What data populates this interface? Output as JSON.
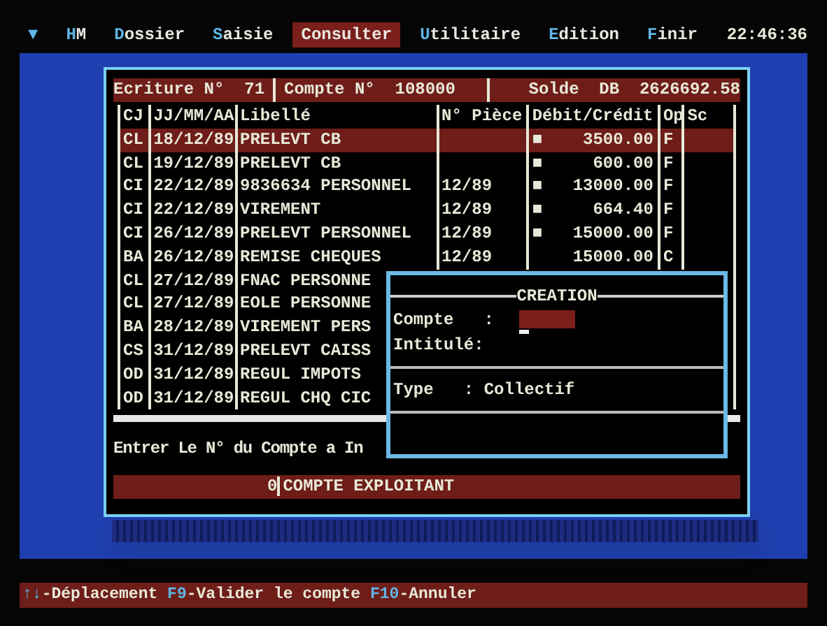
{
  "menu_bar": {
    "items": [
      {
        "label": "▼",
        "selected": false
      },
      {
        "label": "HM",
        "selected": false
      },
      {
        "label": "Dossier",
        "selected": false
      },
      {
        "label": "Saisie",
        "selected": false
      },
      {
        "label": "Consulter",
        "selected": true
      },
      {
        "label": "Utilitaire",
        "selected": false
      },
      {
        "label": "Edition",
        "selected": false
      },
      {
        "label": "Finir",
        "selected": false
      }
    ],
    "clock": "22:46:36"
  },
  "ledger": {
    "header": [
      {
        "label": "Ecriture N°",
        "value": "71"
      },
      {
        "label": "Compte N°",
        "value": "108000"
      },
      {
        "label": "Solde  DB",
        "value": "2626692.58"
      }
    ],
    "columns": [
      "CJ",
      "JJ/MM/AA",
      "Libellé",
      "N° Pièce",
      "Débit/Crédit",
      "Op",
      "Sc"
    ],
    "rows": [
      {
        "cj": "CL",
        "date": "18/12/89",
        "libelle": "PRELEVT CB",
        "sign": "■",
        "amount": "3500.00",
        "op": "F",
        "selected": true
      },
      {
        "cj": "CL",
        "date": "19/12/89",
        "libelle": "PRELEVT CB",
        "sign": "■",
        "amount": "600.00",
        "op": "F",
        "selected": false
      },
      {
        "cj": "CI",
        "date": "22/12/89",
        "libelle": "9836634 PERSONNEL",
        "piece": "12/89",
        "sign": "■",
        "amount": "13000.00",
        "op": "F",
        "selected": false
      },
      {
        "cj": "CI",
        "date": "22/12/89",
        "libelle": "VIREMENT",
        "piece": "12/89",
        "sign": "■",
        "amount": "664.40",
        "op": "F",
        "selected": false
      },
      {
        "cj": "CI",
        "date": "26/12/89",
        "libelle": "PRELEVT PERSONNEL",
        "piece": "12/89",
        "sign": "■",
        "amount": "15000.00",
        "op": "F",
        "selected": false
      },
      {
        "cj": "BA",
        "date": "26/12/89",
        "libelle": "REMISE CHEQUES",
        "piece": "12/89",
        "amount": "15000.00",
        "op": "C",
        "selected": false
      },
      {
        "cj": "CL",
        "date": "27/12/89",
        "libelle": "FNAC PERSONNE",
        "selected": false
      },
      {
        "cj": "CL",
        "date": "27/12/89",
        "libelle": "EOLE PERSONNE",
        "selected": false
      },
      {
        "cj": "BA",
        "date": "28/12/89",
        "libelle": "VIREMENT PERS",
        "selected": false
      },
      {
        "cj": "CS",
        "date": "31/12/89",
        "libelle": "PRELEVT CAISS",
        "selected": false
      },
      {
        "cj": "OD",
        "date": "31/12/89",
        "libelle": "REGUL IMPOTS",
        "selected": false
      },
      {
        "cj": "OD",
        "date": "31/12/89",
        "libelle": "REGUL CHQ CIC",
        "selected": false
      }
    ],
    "prompt": "Entrer Le N° du Compte a In",
    "account_bar": {
      "number": "0",
      "label": "COMPTE EXPLOITANT"
    }
  },
  "dialog": {
    "title": "CREATION",
    "fields": [
      {
        "label": "Compte   :",
        "kind": "input"
      },
      {
        "label": "Intitulé:",
        "kind": "text"
      }
    ],
    "type": {
      "label": "Type",
      "value": ": Collectif"
    }
  },
  "status_bar": [
    {
      "key": "↑↓",
      "label": "-Déplacement"
    },
    {
      "key": "F9",
      "label": "-Valider le compte"
    },
    {
      "key": "F10",
      "label": "-Annuler"
    }
  ]
}
